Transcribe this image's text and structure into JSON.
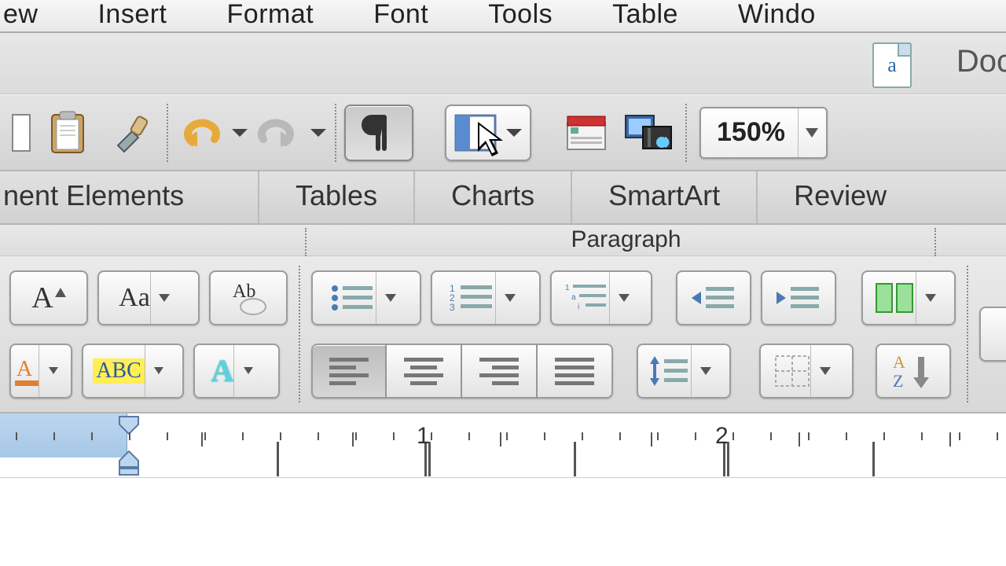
{
  "menubar": {
    "items": [
      "ew",
      "Insert",
      "Format",
      "Font",
      "Tools",
      "Table",
      "Windo"
    ]
  },
  "titlebar": {
    "doc_glyph": "a",
    "doc_label": "Doc"
  },
  "toolbar": {
    "zoom_value": "150%"
  },
  "tabs": {
    "items": [
      "nent Elements",
      "Tables",
      "Charts",
      "SmartArt",
      "Review"
    ]
  },
  "ribbon": {
    "group_label": "Paragraph",
    "highlight_text": "ABC"
  },
  "ruler": {
    "marks": [
      "1",
      "2"
    ]
  }
}
